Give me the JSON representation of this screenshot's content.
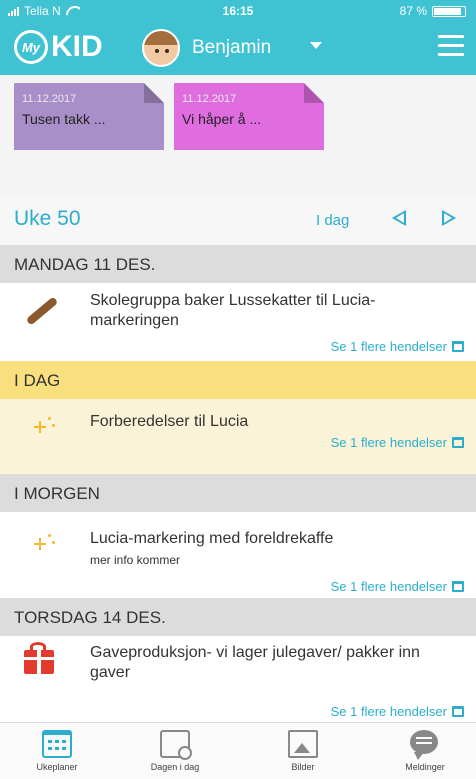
{
  "status_bar": {
    "carrier": "Telia N",
    "time": "16:15",
    "battery": "87 %"
  },
  "app_bar": {
    "logo_badge": "My",
    "logo_text": "KID",
    "child_name": "Benjamin"
  },
  "notes": [
    {
      "date": "11.12.2017",
      "text": "Tusen takk    ...",
      "color": "#a98fc9"
    },
    {
      "date": "11.12.2017",
      "text": "Vi håper å    ...",
      "color": "#e06de0"
    }
  ],
  "week": {
    "title": "Uke 50",
    "today_label": "I dag"
  },
  "days": [
    {
      "header": "MANDAG 11 DES.",
      "event_title": "Skolegruppa baker Lussekatter til Lucia-markeringen",
      "event_sub": "",
      "more": "Se 1 flere hendelser"
    },
    {
      "header": "I DAG",
      "event_title": "Forberedelser til Lucia",
      "event_sub": "",
      "more": "Se 1 flere hendelser"
    },
    {
      "header": "I MORGEN",
      "event_title": "Lucia-markering med foreldrekaffe",
      "event_sub": "mer info kommer",
      "more": "Se 1 flere hendelser"
    },
    {
      "header": "TORSDAG 14 DES.",
      "event_title": "Gaveproduksjon- vi lager julegaver/ pakker inn gaver",
      "event_sub": "",
      "more": "Se 1 flere hendelser"
    }
  ],
  "tabs": [
    {
      "label": "Ukeplaner",
      "icon": "calendar-week-icon"
    },
    {
      "label": "Dagen i dag",
      "icon": "calendar-clock-icon"
    },
    {
      "label": "Bilder",
      "icon": "photo-icon"
    },
    {
      "label": "Meldinger",
      "icon": "chat-icon"
    }
  ],
  "colors": {
    "brand": "#3fc3d2",
    "accent": "#2aaecb",
    "today_header": "#f9df7e",
    "today_event": "#fbf3d8"
  }
}
